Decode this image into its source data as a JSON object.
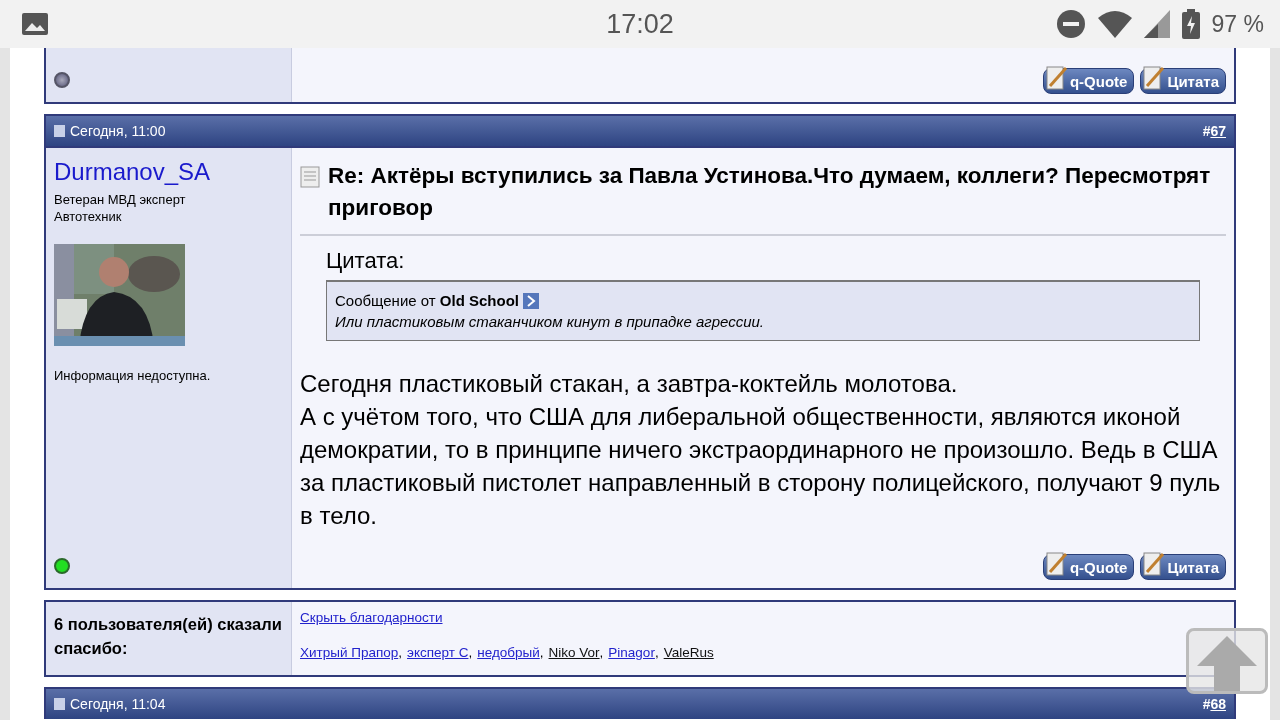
{
  "status_bar": {
    "time": "17:02",
    "battery": "97 %"
  },
  "prev_post": {
    "online": false,
    "buttons": [
      "q-Quote",
      "Цитата"
    ]
  },
  "post": {
    "date": "Сегодня, 11:00",
    "number_prefix": "#",
    "number": "67",
    "author": "Durmanov_SA",
    "author_title": [
      "Ветеран МВД эксперт",
      "Автотехник"
    ],
    "info": "Информация недоступна.",
    "online": true,
    "title": "Re: Актёры вступились за Павла Устинова.Что думаем, коллеги? Пересмотрят приговор",
    "quote": {
      "label": "Цитата:",
      "from_prefix": "Сообщение от",
      "from": "Old School",
      "text": "Или пластиковым стаканчиком кинут в припадке агрессии."
    },
    "body": [
      "Сегодня пластиковый стакан, а завтра-коктейль молотова.",
      "А с учётом того, что США для либеральной общественности, являются иконой демократии, то в принципе ничего экстраординарного не произошло. Ведь в США за пластиковый пистолет направленный в сторону полицейского, получают 9 пуль в тело."
    ],
    "buttons": [
      "q-Quote",
      "Цитата"
    ]
  },
  "thanks": {
    "label": "6 пользователя(ей) сказали спасибо:",
    "hide_link": "Скрыть благодарности",
    "separator": ",",
    "users": [
      {
        "name": "Хитрый Прапор",
        "linked": true
      },
      {
        "name": "эксперт С",
        "linked": true
      },
      {
        "name": "недобрый",
        "linked": true
      },
      {
        "name": "Niko Vor",
        "linked": false
      },
      {
        "name": "Pinagor",
        "linked": true
      },
      {
        "name": "ValeRus",
        "linked": false
      }
    ]
  },
  "next_post": {
    "date": "Сегодня, 11:04",
    "number_prefix": "#",
    "number": "68"
  }
}
